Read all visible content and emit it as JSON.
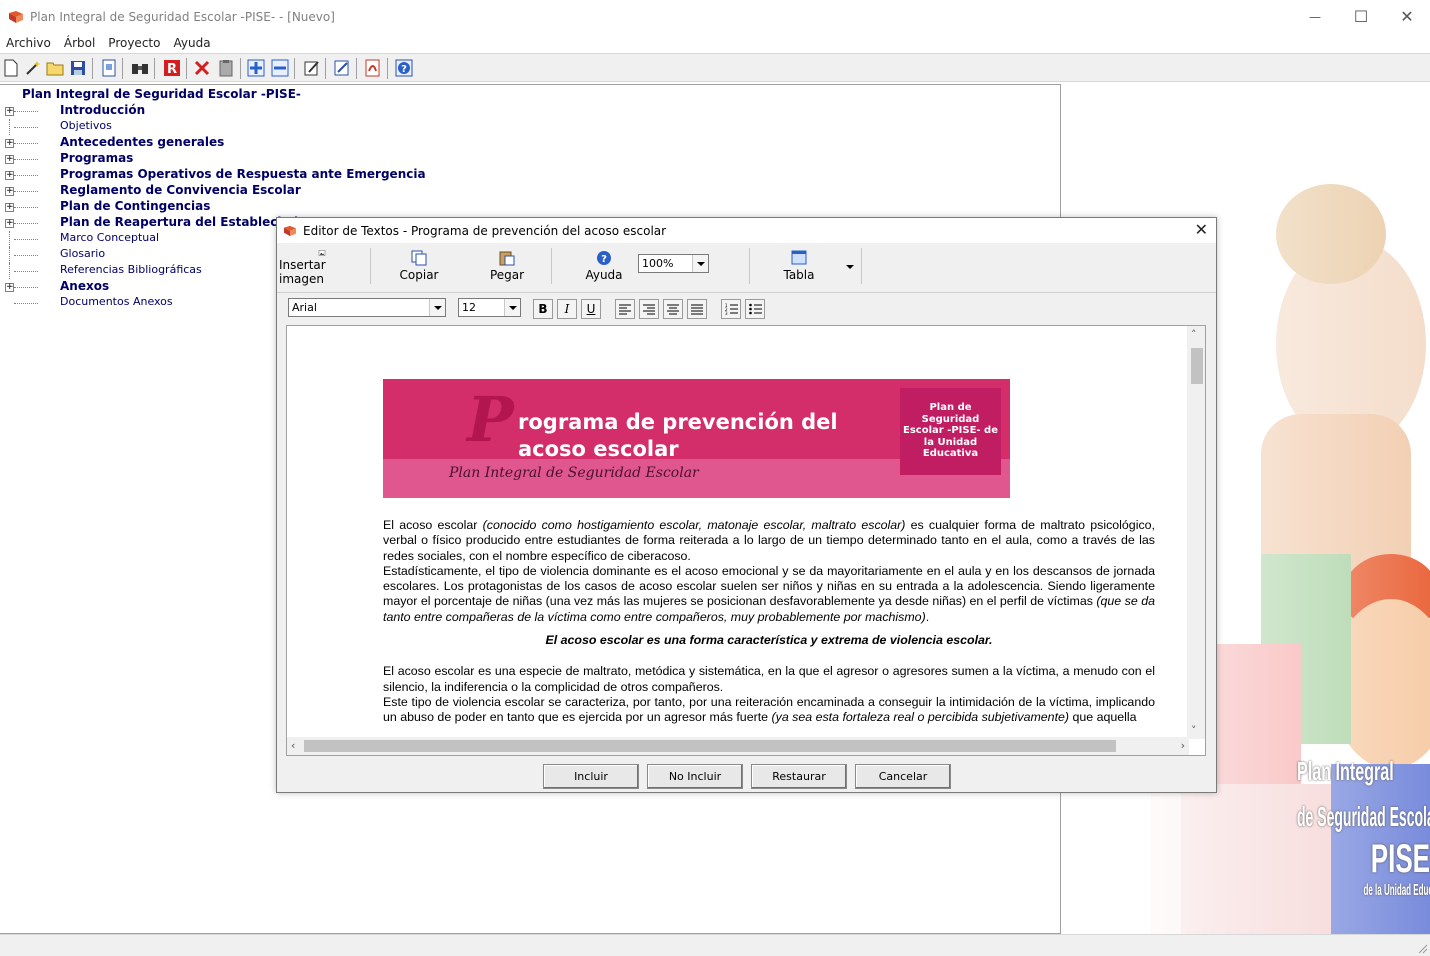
{
  "window": {
    "title": "Plan Integral de Seguridad Escolar -PISE- - [Nuevo]",
    "minimize": "—",
    "maximize": "☐",
    "close": "✕"
  },
  "menu": [
    "Archivo",
    "Árbol",
    "Proyecto",
    "Ayuda"
  ],
  "toolbar_icons": [
    "new-file-icon",
    "magic-wand-icon",
    "open-folder-icon",
    "save-icon",
    "preview-icon",
    "search-binoculars-icon",
    "report-r-icon",
    "delete-x-icon",
    "clipboard-icon",
    "add-node-icon",
    "remove-node-icon",
    "edit-node-icon",
    "edit-text-icon",
    "pdf-export-icon",
    "help-icon"
  ],
  "tree": {
    "root": "Plan Integral de Seguridad Escolar -PISE-",
    "items": [
      {
        "label": "Introducción",
        "bold": true,
        "expandable": true
      },
      {
        "label": "Objetivos",
        "bold": false,
        "expandable": false
      },
      {
        "label": "Antecedentes generales",
        "bold": true,
        "expandable": true
      },
      {
        "label": "Programas",
        "bold": true,
        "expandable": true
      },
      {
        "label": "Programas Operativos de Respuesta ante Emergencia",
        "bold": true,
        "expandable": true
      },
      {
        "label": "Reglamento de Convivencia Escolar",
        "bold": true,
        "expandable": true
      },
      {
        "label": "Plan de Contingencias",
        "bold": true,
        "expandable": true
      },
      {
        "label": "Plan de Reapertura del Establecimient",
        "bold": true,
        "expandable": true
      },
      {
        "label": "Marco Conceptual",
        "bold": false,
        "expandable": false
      },
      {
        "label": "Glosario",
        "bold": false,
        "expandable": false
      },
      {
        "label": "Referencias Bibliográficas",
        "bold": false,
        "expandable": false
      },
      {
        "label": "Anexos",
        "bold": true,
        "expandable": true
      },
      {
        "label": "Documentos Anexos",
        "bold": false,
        "expandable": false
      }
    ]
  },
  "side_art": {
    "line1": "Plan Integral",
    "line2": "de Seguridad Escolar",
    "line3": "PISE",
    "line4": "de la Unidad Educativa"
  },
  "dialog": {
    "title": "Editor de Textos - Programa de prevención del acoso escolar",
    "close": "✕",
    "tools": {
      "insert_image": "Insertar imagen",
      "copy": "Copiar",
      "paste": "Pegar",
      "help": "Ayuda",
      "zoom": "100%",
      "table": "Tabla"
    },
    "format": {
      "font": "Arial",
      "size": "12",
      "bold": "B",
      "italic": "I",
      "underline": "U"
    },
    "banner": {
      "letter": "P",
      "title": "rograma de prevención del acoso escolar",
      "subtitle": "Plan Integral de Seguridad Escolar",
      "box": "Plan de Seguridad Escolar -PISE- de la Unidad Educativa"
    },
    "paragraphs": {
      "p1_a": "El acoso escolar ",
      "p1_b": "(conocido como hostigamiento escolar, matonaje escolar, maltrato escolar)",
      "p1_c": " es cualquier forma de maltrato psicológico, verbal o físico producido entre estudiantes de forma reiterada a lo largo de un tiempo determinado tanto en el aula, como a través de las redes sociales, con el nombre específico de ciberacoso.",
      "p2_a": "Estadísticamente, el tipo de violencia dominante es el acoso emocional y se da mayoritariamente en el aula y en los descansos de jornada escolares. Los protagonistas de los casos de acoso escolar suelen ser niños y niñas en su entrada a la adolescencia. Siendo ligeramente mayor el porcentaje de niñas (una vez más las mujeres se posicionan desfavorablemente ya desde niñas) en el perfil de víctimas ",
      "p2_b": "(que se da tanto entre compañeras de la víctima como entre compañeros, muy probablemente por machismo)",
      "p2_c": ".",
      "highlight": "El acoso escolar es una forma característica y extrema de violencia escolar.",
      "p3": "El acoso escolar es una especie de maltrato, metódica y sistemática, en la que el agresor o agresores sumen a la víctima, a menudo con el silencio, la indiferencia o la complicidad de otros compañeros.",
      "p4_a": "Este tipo de violencia escolar se caracteriza, por tanto, por una reiteración encaminada a conseguir la intimidación de la víctima, implicando un abuso de poder en tanto que es ejercida por un agresor más fuerte ",
      "p4_b": "(ya sea esta fortaleza real o percibida subjetivamente)",
      "p4_c": " que aquella"
    },
    "buttons": {
      "include": "Incluir",
      "not_include": "No Incluir",
      "restore": "Restaurar",
      "cancel": "Cancelar"
    }
  },
  "colors": {
    "tree_text": "#000066",
    "banner_pink": "#d42e6a",
    "banner_box": "#c01d63"
  }
}
